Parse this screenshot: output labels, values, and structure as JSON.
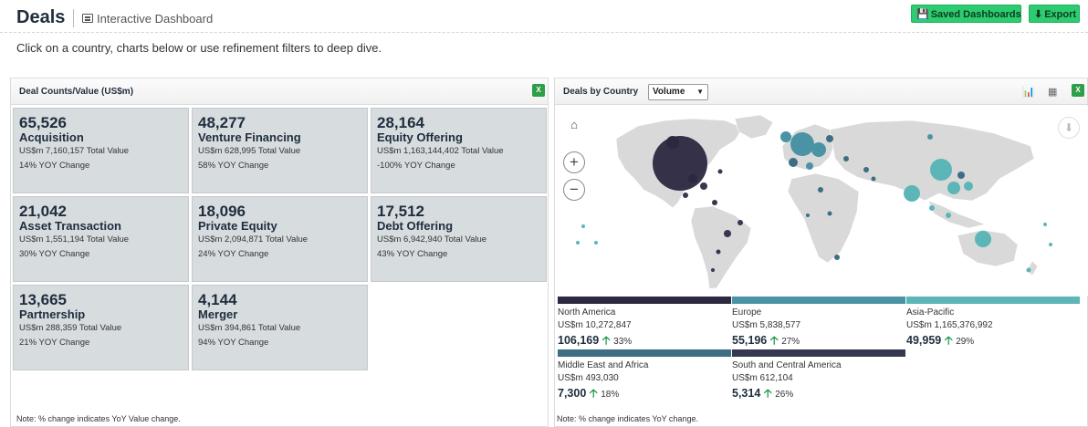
{
  "header": {
    "title": "Deals",
    "subtitle": "Interactive Dashboard",
    "saved_dashboards_label": "Saved Dashboards",
    "export_label": "Export",
    "button_color": "#2ecc71"
  },
  "instruction": "Click on a country, charts below or use refinement filters to deep dive.",
  "left_panel": {
    "title": "Deal Counts/Value (US$m)",
    "tiles": [
      {
        "count": "65,526",
        "type": "Acquisition",
        "value": "US$m 7,160,157 Total Value",
        "yoy": "14% YOY Change"
      },
      {
        "count": "48,277",
        "type": "Venture Financing",
        "value": "US$m 628,995 Total Value",
        "yoy": "58% YOY Change"
      },
      {
        "count": "28,164",
        "type": "Equity Offering",
        "value": "US$m 1,163,144,402 Total Value",
        "yoy": "-100% YOY Change"
      },
      {
        "count": "21,042",
        "type": "Asset Transaction",
        "value": "US$m 1,551,194 Total Value",
        "yoy": "30% YOY Change"
      },
      {
        "count": "18,096",
        "type": "Private Equity",
        "value": "US$m 2,094,871 Total Value",
        "yoy": "24% YOY Change"
      },
      {
        "count": "17,512",
        "type": "Debt Offering",
        "value": "US$m 6,942,940 Total Value",
        "yoy": "43% YOY Change"
      },
      {
        "count": "13,665",
        "type": "Partnership",
        "value": "US$m 288,359 Total Value",
        "yoy": "21% YOY Change"
      },
      {
        "count": "4,144",
        "type": "Merger",
        "value": "US$m 394,861 Total Value",
        "yoy": "94% YOY Change"
      }
    ],
    "note": "Note: % change indicates YoY Value change."
  },
  "right_panel": {
    "title": "Deals by Country",
    "metric_selected": "Volume",
    "regions": [
      {
        "name": "North America",
        "value": "US$m 10,272,847",
        "count": "106,169",
        "change": "33%",
        "color": "#2b2840"
      },
      {
        "name": "Europe",
        "value": "US$m 5,838,577",
        "count": "55,196",
        "change": "27%",
        "color": "#4a93a4"
      },
      {
        "name": "Asia-Pacific",
        "value": "US$m 1,165,376,992",
        "count": "49,959",
        "change": "29%",
        "color": "#5cb6b8"
      },
      {
        "name": "Middle East and Africa",
        "value": "US$m 493,030",
        "count": "7,300",
        "change": "18%",
        "color": "#3d6e84"
      },
      {
        "name": "South and Central America",
        "value": "US$m 612,104",
        "count": "5,314",
        "change": "26%",
        "color": "#353850"
      }
    ],
    "note": "Note: % change indicates YoY change."
  }
}
